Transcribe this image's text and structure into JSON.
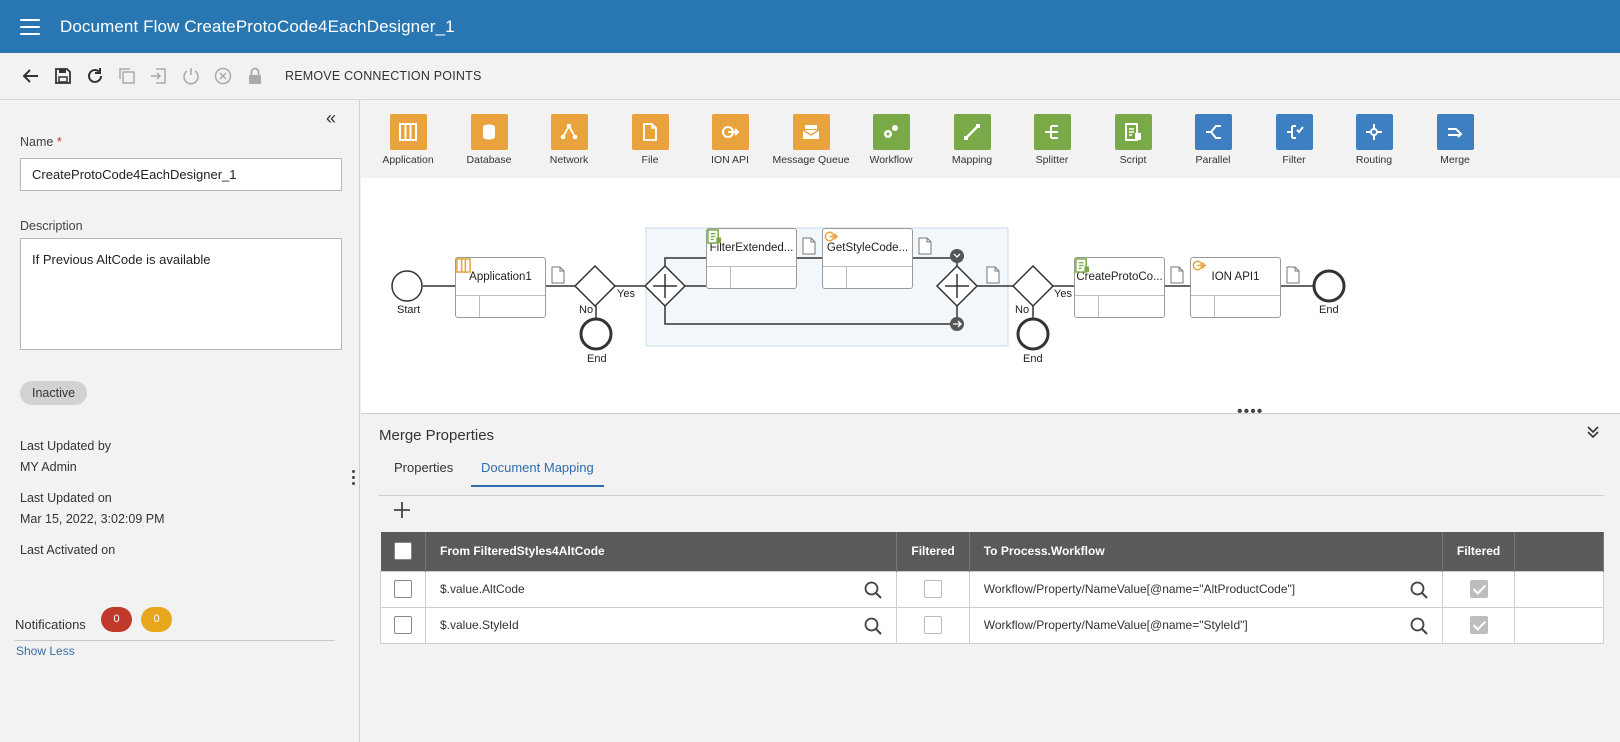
{
  "header": {
    "title": "Document Flow CreateProtoCode4EachDesigner_1"
  },
  "toolbar": {
    "remove_label": "REMOVE CONNECTION POINTS"
  },
  "left": {
    "name_label": "Name",
    "name_required": "*",
    "name_value": "CreateProtoCode4EachDesigner_1",
    "description_label": "Description",
    "description_value": "If Previous AltCode  is available",
    "status": "Inactive",
    "last_updated_by_label": "Last Updated by",
    "last_updated_by_value": "MY Admin",
    "last_updated_on_label": "Last Updated on",
    "last_updated_on_value": "Mar 15, 2022, 3:02:09 PM",
    "last_activated_label": "Last Activated on",
    "notifications_label": "Notifications",
    "notif_red": "0",
    "notif_yellow": "0",
    "show_less": "Show Less"
  },
  "palette": [
    {
      "label": "Application",
      "color": "#e8a33d",
      "icon": "application-icon"
    },
    {
      "label": "Database",
      "color": "#e8a33d",
      "icon": "database-icon"
    },
    {
      "label": "Network",
      "color": "#e8a33d",
      "icon": "network-icon"
    },
    {
      "label": "File",
      "color": "#e8a33d",
      "icon": "file-icon"
    },
    {
      "label": "ION API",
      "color": "#e8a33d",
      "icon": "ion-api-icon"
    },
    {
      "label": "Message Queue",
      "color": "#e8a33d",
      "icon": "message-queue-icon"
    },
    {
      "label": "Workflow",
      "color": "#7aaa47",
      "icon": "workflow-icon"
    },
    {
      "label": "Mapping",
      "color": "#7aaa47",
      "icon": "mapping-icon"
    },
    {
      "label": "Splitter",
      "color": "#7aaa47",
      "icon": "splitter-icon"
    },
    {
      "label": "Script",
      "color": "#7aaa47",
      "icon": "script-icon"
    },
    {
      "label": "Parallel",
      "color": "#3e7fc1",
      "icon": "parallel-icon"
    },
    {
      "label": "Filter",
      "color": "#3e7fc1",
      "icon": "filter-icon"
    },
    {
      "label": "Routing",
      "color": "#3e7fc1",
      "icon": "routing-icon"
    },
    {
      "label": "Merge",
      "color": "#3e7fc1",
      "icon": "merge-icon"
    }
  ],
  "flow": {
    "start_label": "Start",
    "end_label": "End",
    "yes_label": "Yes",
    "no_label": "No",
    "nodes": {
      "application1": "Application1",
      "filter_extended": "FilterExtended...",
      "get_style_code": "GetStyleCode...",
      "create_proto": "CreateProtoCo...",
      "ion_api1": "ION API1"
    }
  },
  "bottom": {
    "title": "Merge Properties",
    "tabs": [
      "Properties",
      "Document Mapping"
    ],
    "columns": [
      "From FilteredStyles4AltCode",
      "Filtered",
      "To Process.Workflow",
      "Filtered"
    ],
    "rows": [
      {
        "from": "$.value.AltCode",
        "to": "Workflow/Property/NameValue[@name=\"AltProductCode\"]"
      },
      {
        "from": "$.value.StyleId",
        "to": "Workflow/Property/NameValue[@name=\"StyleId\"]"
      }
    ]
  }
}
